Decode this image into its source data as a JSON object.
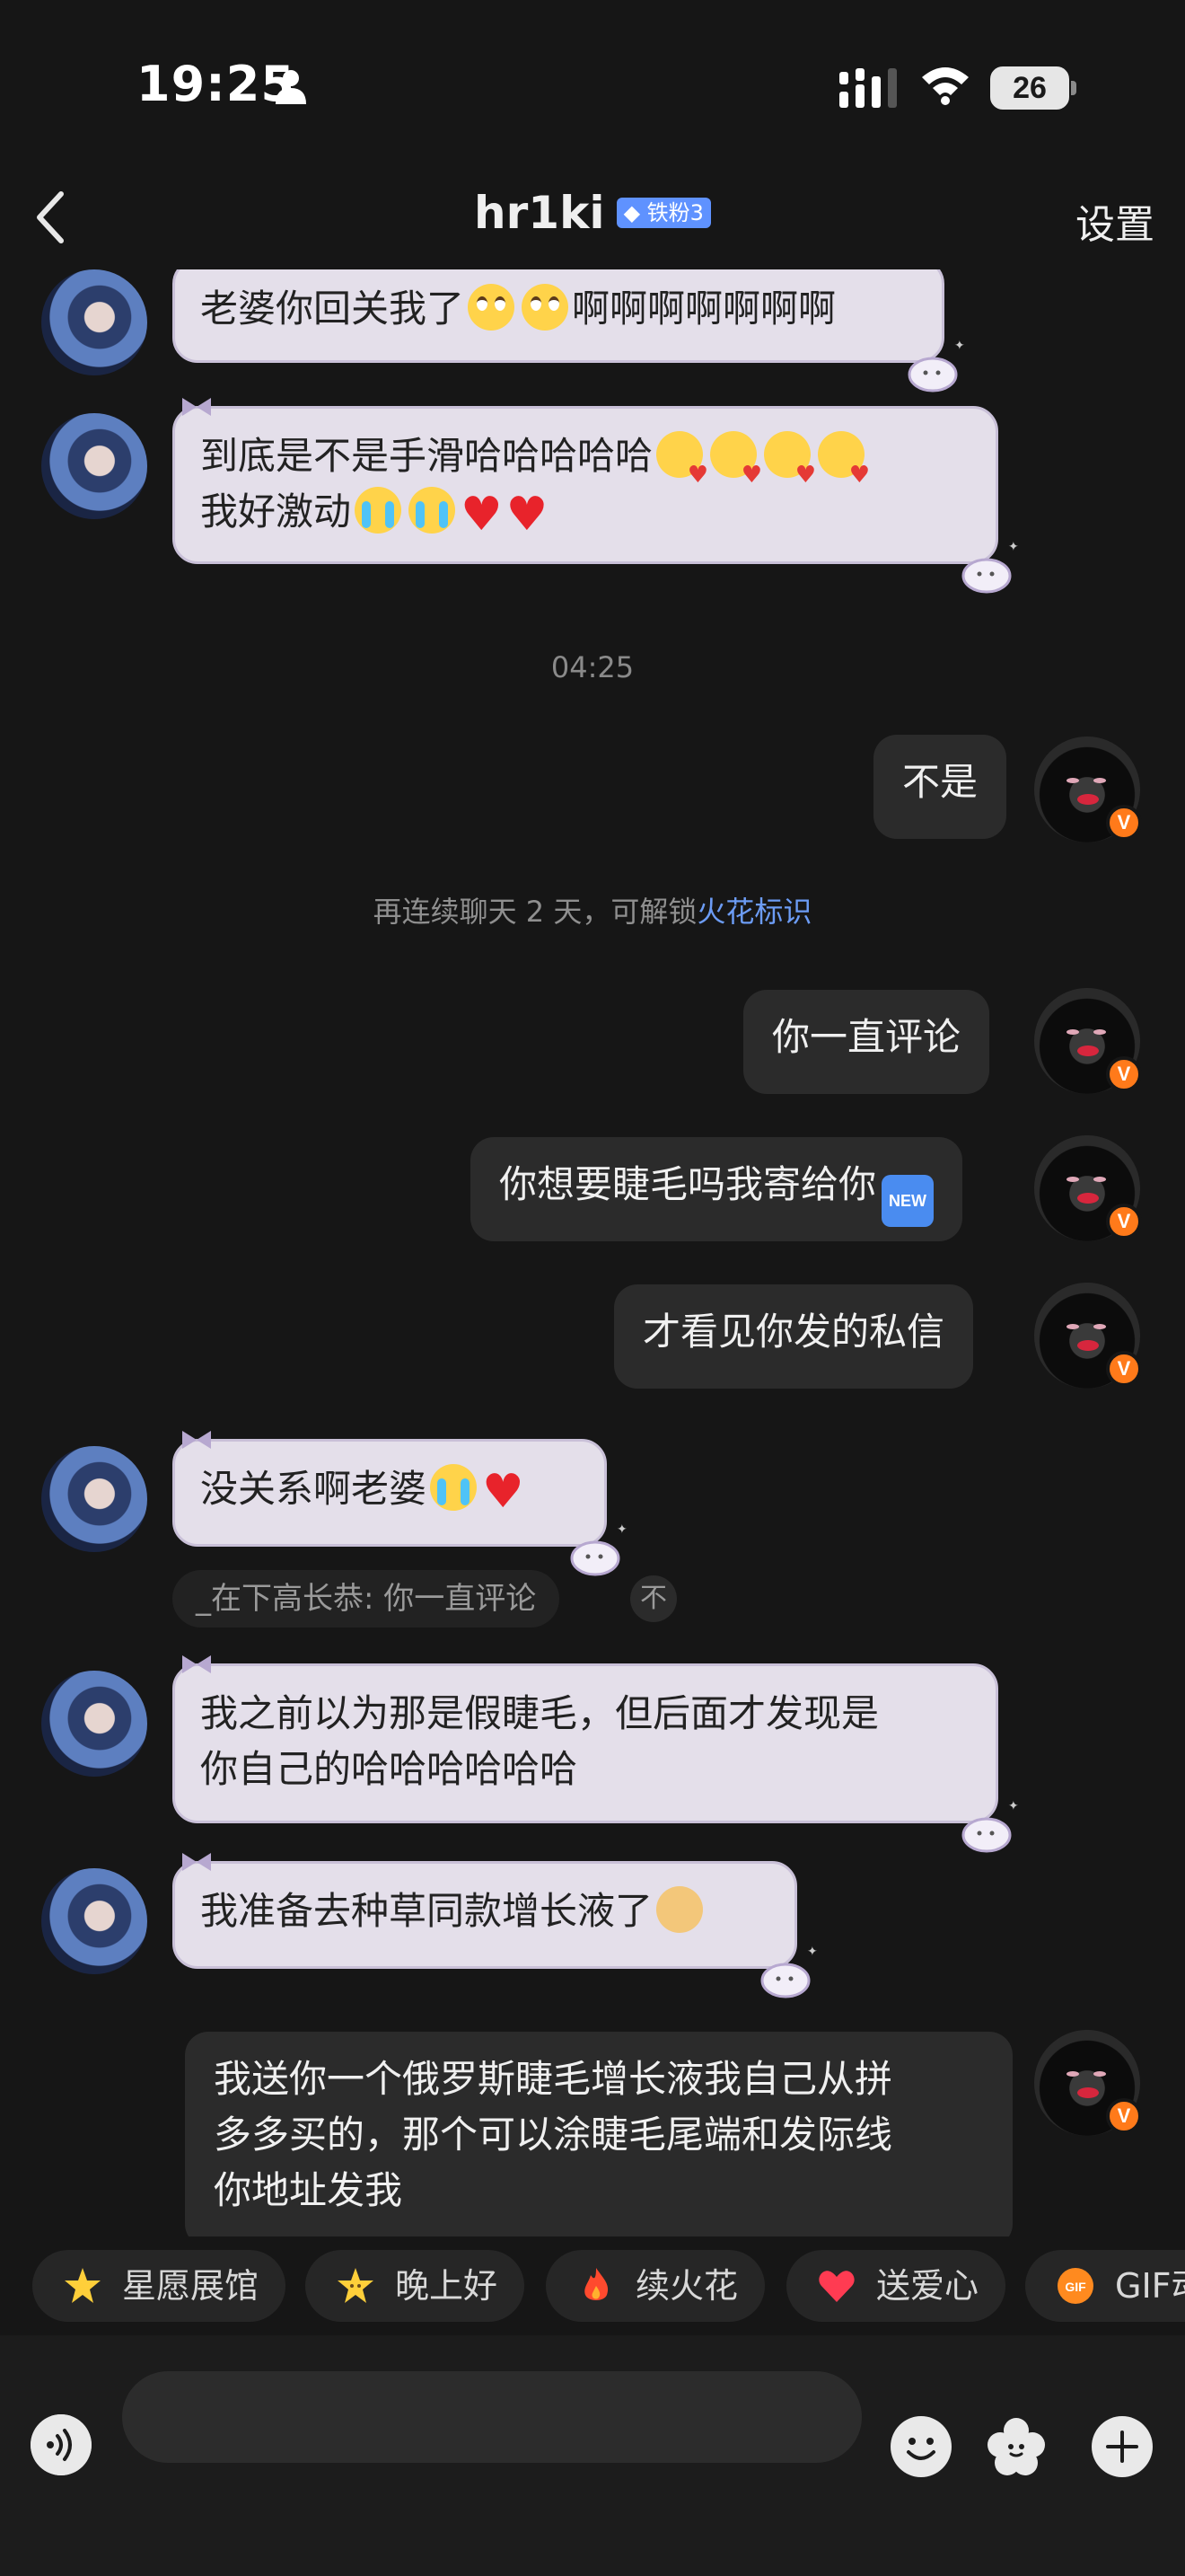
{
  "status_bar": {
    "time": "19:25",
    "battery": "26"
  },
  "header": {
    "title": "hr1ki",
    "badge": "铁粉3",
    "settings": "设置"
  },
  "messages": {
    "m1": "老婆你回关我了",
    "m1_tail": "啊啊啊啊啊啊啊",
    "m2_line1": "到底是不是手滑哈哈哈哈哈",
    "m2_line2": "我好激动",
    "timestamp": "04:25",
    "m3": "不是",
    "system_note": "再连续聊天 2 天，可解锁",
    "system_link": "火花标识",
    "m4": "你一直评论",
    "m5": "你想要睫毛吗我寄给你",
    "m5_tag": "NEW",
    "m6": "才看见你发的私信",
    "m7": "没关系啊老婆",
    "quote": "_在下高长恭: 你一直评论",
    "quote_close": "不",
    "m8_line1": "我之前以为那是假睫毛，但后面才发现是",
    "m8_line2": "你自己的哈哈哈哈哈哈",
    "m9": "我准备去种草同款增长液了",
    "m10_line1": "我送你一个俄罗斯睫毛增长液我自己从拼",
    "m10_line2": "多多买的，那个可以涂睫毛尾端和发际线",
    "m10_line3": "你地址发我",
    "avatar_badge": "V"
  },
  "quick_replies": [
    {
      "label": "星愿展馆",
      "icon": "star-icon"
    },
    {
      "label": "晚上好",
      "icon": "star-face-icon"
    },
    {
      "label": "续火花",
      "icon": "fire-icon"
    },
    {
      "label": "送爱心",
      "icon": "heart-icon"
    },
    {
      "label": "GIF动",
      "icon": "gif-icon"
    }
  ],
  "colors": {
    "background": "#161616",
    "bubble_left": "#e4dfea",
    "bubble_right": "#2b2b2b",
    "link": "#6c9cf5",
    "badge": "#5f92ff"
  }
}
